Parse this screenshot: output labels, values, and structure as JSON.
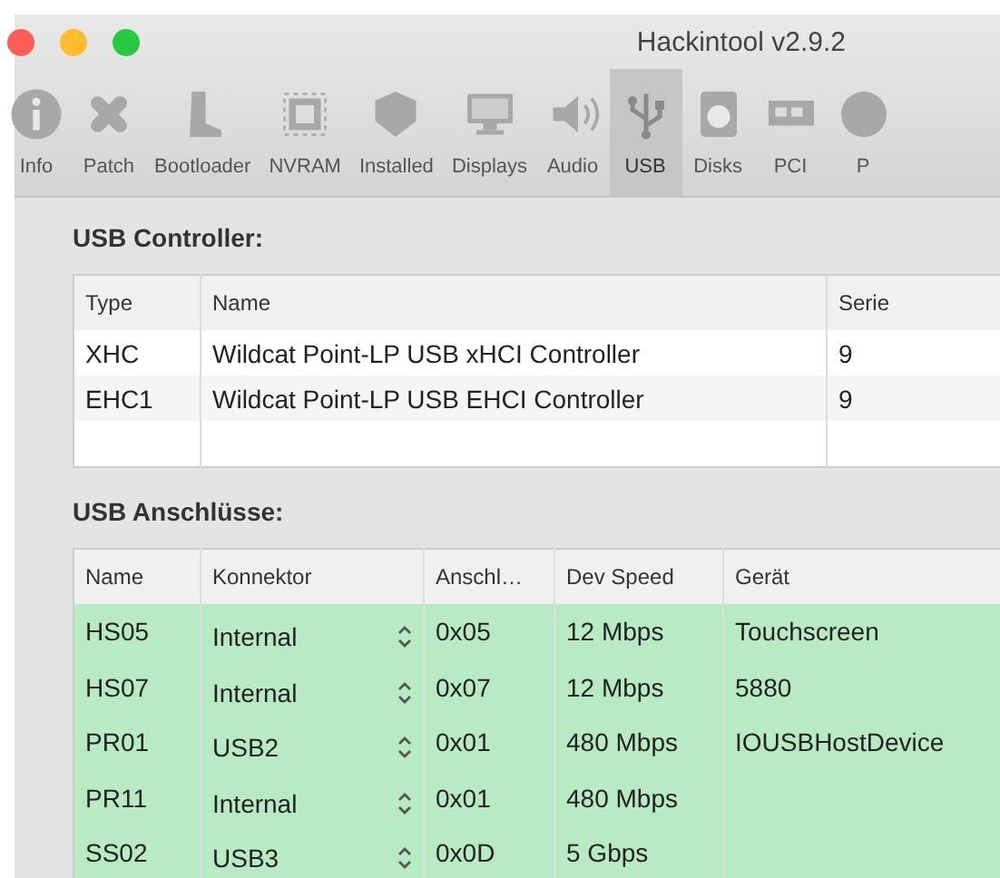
{
  "window": {
    "title": "Hackintool v2.9.2"
  },
  "toolbar": [
    {
      "label": "Info",
      "selected": false
    },
    {
      "label": "Patch",
      "selected": false
    },
    {
      "label": "Bootloader",
      "selected": false
    },
    {
      "label": "NVRAM",
      "selected": false
    },
    {
      "label": "Installed",
      "selected": false
    },
    {
      "label": "Displays",
      "selected": false
    },
    {
      "label": "Audio",
      "selected": false
    },
    {
      "label": "USB",
      "selected": true
    },
    {
      "label": "Disks",
      "selected": false
    },
    {
      "label": "PCI",
      "selected": false
    },
    {
      "label": "P",
      "selected": false
    }
  ],
  "controllers": {
    "heading": "USB Controller:",
    "columns": [
      "Type",
      "Name",
      "Serie"
    ],
    "rows": [
      [
        "XHC",
        "Wildcat Point-LP USB xHCI Controller",
        "9"
      ],
      [
        "EHC1",
        "Wildcat Point-LP USB EHCI Controller",
        "9"
      ]
    ]
  },
  "ports": {
    "heading": "USB Anschlüsse:",
    "columns": [
      "Name",
      "Konnektor",
      "Anschl…",
      "Dev Speed",
      "Gerät"
    ],
    "rows": [
      {
        "name": "HS05",
        "connector": "Internal",
        "port": "0x05",
        "speed": "12 Mbps",
        "device": "Touchscreen"
      },
      {
        "name": "HS07",
        "connector": "Internal",
        "port": "0x07",
        "speed": "12 Mbps",
        "device": "5880"
      },
      {
        "name": "PR01",
        "connector": "USB2",
        "port": "0x01",
        "speed": "480 Mbps",
        "device": "IOUSBHostDevice"
      },
      {
        "name": "PR11",
        "connector": "Internal",
        "port": "0x01",
        "speed": "480 Mbps"
      },
      {
        "name": "SS02",
        "connector": "USB3",
        "port": "0x0D",
        "speed": "5 Gbps"
      }
    ]
  }
}
